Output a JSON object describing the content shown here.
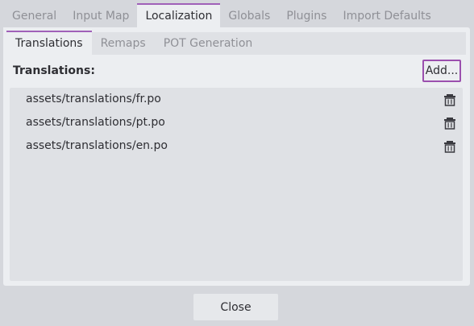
{
  "top_tabs": [
    {
      "label": "General",
      "active": false
    },
    {
      "label": "Input Map",
      "active": false
    },
    {
      "label": "Localization",
      "active": true
    },
    {
      "label": "Globals",
      "active": false
    },
    {
      "label": "Plugins",
      "active": false
    },
    {
      "label": "Import Defaults",
      "active": false
    }
  ],
  "sub_tabs": [
    {
      "label": "Translations",
      "active": true
    },
    {
      "label": "Remaps",
      "active": false
    },
    {
      "label": "POT Generation",
      "active": false
    }
  ],
  "translations": {
    "label": "Translations:",
    "add_label": "Add...",
    "items": [
      {
        "path": "assets/translations/fr.po",
        "icon": "trash-icon"
      },
      {
        "path": "assets/translations/pt.po",
        "icon": "trash-icon"
      },
      {
        "path": "assets/translations/en.po",
        "icon": "trash-icon"
      }
    ]
  },
  "footer": {
    "close_label": "Close"
  },
  "colors": {
    "accent": "#9b4fae",
    "background": "#d5d7dc",
    "panel": "#eceef1",
    "list": "#dfe1e5"
  }
}
